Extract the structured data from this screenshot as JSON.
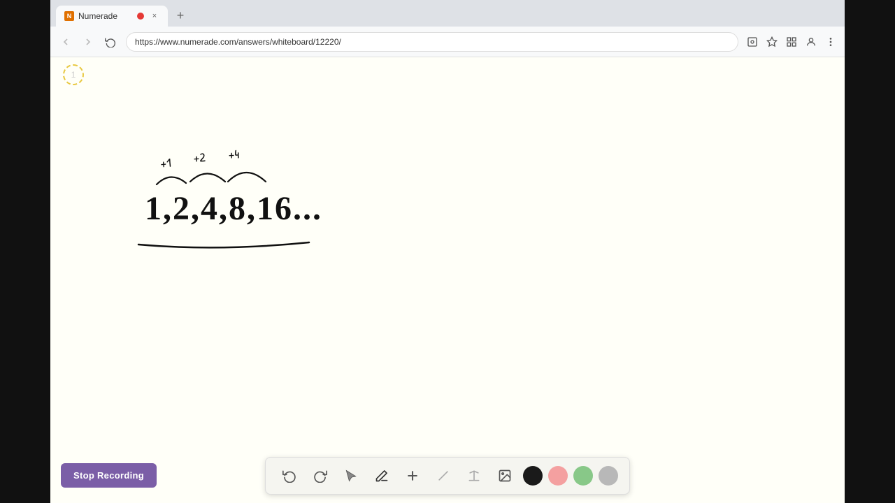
{
  "browser": {
    "tab": {
      "title": "Numerade",
      "favicon_label": "N",
      "close_label": "×",
      "new_tab_label": "+"
    },
    "nav": {
      "back_icon": "←",
      "forward_icon": "→",
      "refresh_icon": "↻",
      "url": "https://www.numerade.com/answers/whiteboard/12220/",
      "bookmark_icon": "☆",
      "extensions_icon": "⊞",
      "account_icon": "◯",
      "menu_icon": "⋮"
    }
  },
  "toolbar": {
    "undo_label": "↺",
    "redo_label": "↻",
    "select_label": "▲",
    "pen_label": "✏",
    "add_label": "+",
    "eraser_label": "/",
    "text_label": "A",
    "image_label": "🖼",
    "colors": [
      "black",
      "pink",
      "green",
      "gray"
    ]
  },
  "stop_recording_button": {
    "label": "Stop Recording"
  },
  "page_indicator": {
    "number": "1"
  }
}
